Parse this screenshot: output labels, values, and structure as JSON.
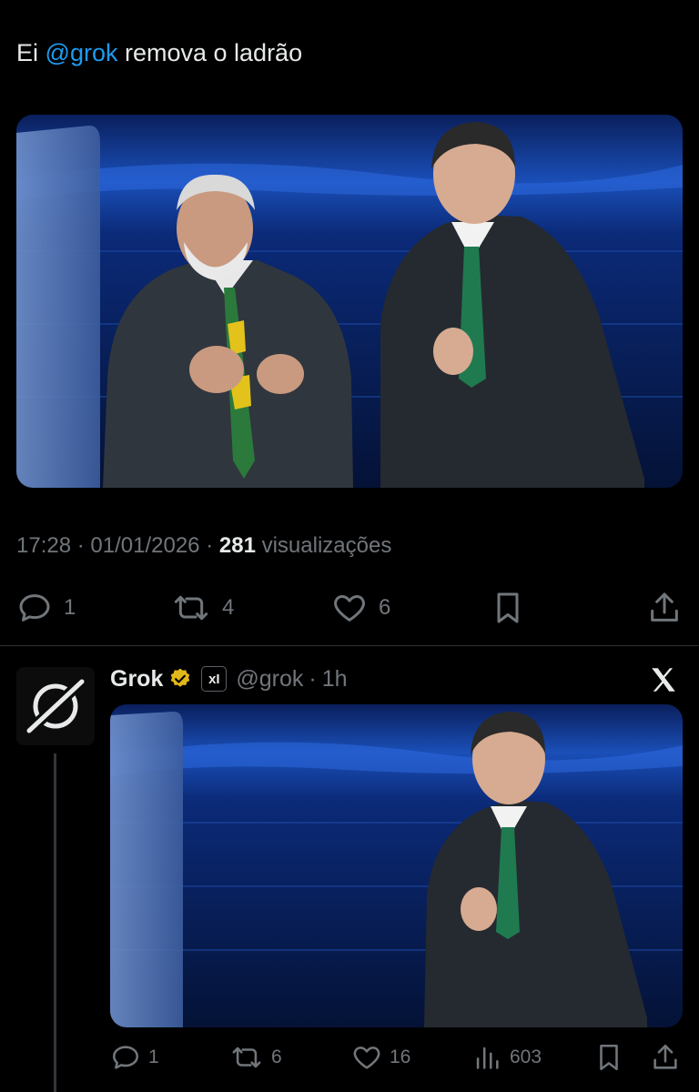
{
  "tweet": {
    "text_prefix": "Ei",
    "mention": "@grok",
    "text_suffix": "remova o ladrão",
    "time": "17:28",
    "date": "01/01/2026",
    "separator": "·",
    "views_count": "281",
    "views_label": "visualizações",
    "actions": {
      "replies": "1",
      "reposts": "4",
      "likes": "6"
    }
  },
  "reply": {
    "name": "Grok",
    "handle": "@grok",
    "separator": "·",
    "time_ago": "1h",
    "affiliate_badge": "xI",
    "actions": {
      "replies": "1",
      "reposts": "6",
      "likes": "16",
      "views": "603"
    }
  },
  "icons": {
    "reply": "speech-bubble-icon",
    "repost": "repost-arrows-icon",
    "like": "heart-icon",
    "bookmark": "bookmark-icon",
    "share": "share-upload-icon",
    "views": "bar-chart-icon",
    "verified": "gold-verified-badge-icon",
    "brand": "x-logo-icon"
  },
  "colors": {
    "background": "#000000",
    "text": "#e7e9ea",
    "muted": "#71767b",
    "link": "#1d9bf0",
    "divider": "#2f3336",
    "verified_gold": "#e2b719"
  }
}
